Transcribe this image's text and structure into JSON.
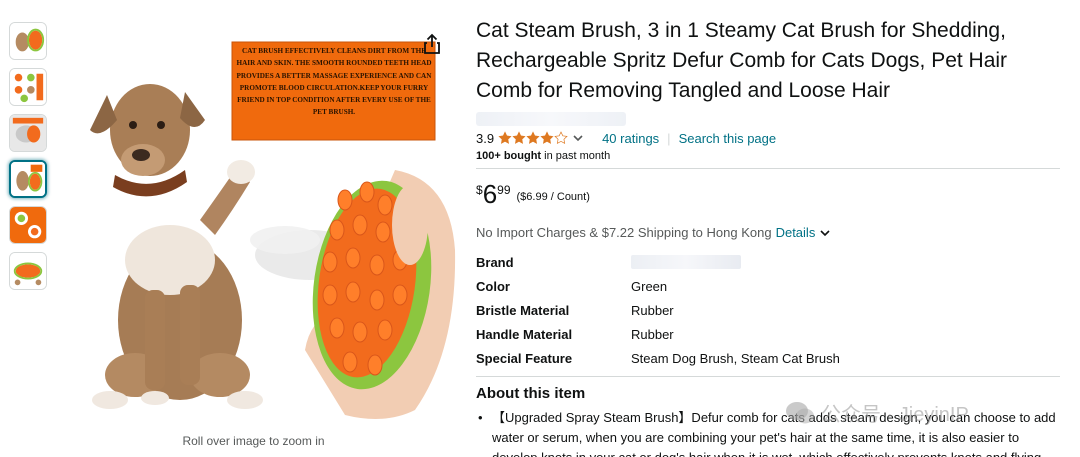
{
  "product": {
    "title": "Cat Steam Brush, 3 in 1 Steamy Cat Brush for Shedding, Rechargeable Spritz Defur Comb for Cats Dogs, Pet Hair Comb for Removing Tangled and Loose Hair",
    "rating": "3.9",
    "rating_value": 3.9,
    "ratings_count": "40 ratings",
    "search_page": "Search this page",
    "bought_bold": "100+ bought",
    "bought_rest": " in past month"
  },
  "price": {
    "symbol": "$",
    "whole": "6",
    "fraction": "99",
    "unit": "($6.99 / Count)"
  },
  "shipping": {
    "text": "No Import Charges & $7.22 Shipping to Hong Kong",
    "details": "Details"
  },
  "specs": [
    {
      "label": "Brand",
      "value": ""
    },
    {
      "label": "Color",
      "value": "Green"
    },
    {
      "label": "Bristle Material",
      "value": "Rubber"
    },
    {
      "label": "Handle Material",
      "value": "Rubber"
    },
    {
      "label": "Special Feature",
      "value": "Steam Dog Brush, Steam Cat Brush"
    }
  ],
  "about": {
    "title": "About this item",
    "bullets": [
      "【Upgraded Spray Steam Brush】Defur comb for cats adds steam design, you can choose to add water or serum, when you are combining your pet's hair at the same time, it is also easier to develop knots in your cat or dog's hair when it is wet, which effectively prevents knots and flying"
    ]
  },
  "gallery": {
    "zoom_hint": "Roll over image to zoom in",
    "promo_text": "CAT BRUSH EFFECTIVELY CLEANS DIRT FROM THE HAIR AND SKIN. THE SMOOTH ROUNDED TEETH HEAD PROVIDES A BETTER MASSAGE EXPERIENCE AND CAN PROMOTE BLOOD CIRCULATION.KEEP YOUR FURRY FRIEND IN TOP CONDITION AFTER EVERY USE OF THE PET BRUSH.",
    "thumbnails": [
      "thumb-1",
      "thumb-2",
      "thumb-3",
      "thumb-4",
      "thumb-5",
      "thumb-6"
    ],
    "selected_index": 3
  },
  "watermark": {
    "text": "公众号 · JieyinIP"
  },
  "colors": {
    "link": "#007185",
    "star": "#de7921",
    "brush_orange": "#f26b1d",
    "brush_green": "#8cc63f",
    "promo_bg": "#f06a0d"
  }
}
